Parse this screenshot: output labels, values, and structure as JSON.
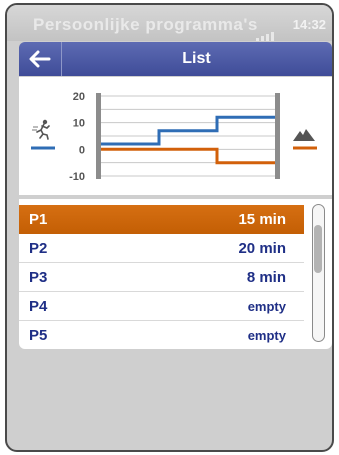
{
  "status_bar": {
    "title": "Persoonlijke programma's",
    "time": "14:32"
  },
  "header": {
    "title": "List"
  },
  "chart_data": {
    "type": "line",
    "y_ticks": [
      "20",
      "10",
      "0",
      "-10"
    ],
    "ylim": [
      -10,
      20
    ],
    "grid": true,
    "series": [
      {
        "color": "#2f6db5",
        "values": [
          2,
          2,
          7,
          7,
          12,
          12
        ]
      },
      {
        "color": "#d2600a",
        "values": [
          0,
          0,
          0,
          0,
          -5,
          -5
        ]
      }
    ],
    "segments": [
      0,
      1,
      2,
      3
    ],
    "left_icon": "runner-icon",
    "right_icon": "mountain-icon"
  },
  "list": {
    "items": [
      {
        "label": "P1",
        "value": "15 min",
        "selected": true
      },
      {
        "label": "P2",
        "value": "20 min",
        "selected": false
      },
      {
        "label": "P3",
        "value": "8 min",
        "selected": false
      },
      {
        "label": "P4",
        "value": "empty",
        "selected": false
      },
      {
        "label": "P5",
        "value": "empty",
        "selected": false
      }
    ]
  },
  "colors": {
    "selected": "#c45f05",
    "header": "#3f4c98",
    "text": "#1f2f86"
  }
}
